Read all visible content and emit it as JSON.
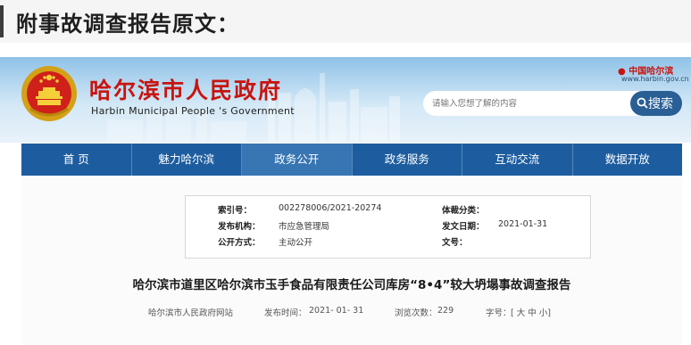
{
  "heading": "附事故调查报告原文：",
  "site": {
    "title": "哈尔滨市人民政府",
    "subtitle": "Harbin Municipal People 's Government",
    "china_logo": "中国哈尔滨",
    "china_url": "www.harbin.gov.cn"
  },
  "search": {
    "placeholder": "请输入您想了解的内容",
    "button": "搜索"
  },
  "nav": {
    "items": [
      "首 页",
      "魅力哈尔滨",
      "政务公开",
      "政务服务",
      "互动交流",
      "数据开放"
    ],
    "active_index": 2
  },
  "info": {
    "index_label": "索引号：",
    "index_value": "002278006/2021-20274",
    "genre_label": "体裁分类：",
    "genre_value": "",
    "org_label": "发布机构：",
    "org_value": "市应急管理局",
    "date_label": "发文日期：",
    "date_value": "2021-01-31",
    "mode_label": "公开方式：",
    "mode_value": "主动公开",
    "doc_label": "文号：",
    "doc_value": ""
  },
  "article": {
    "title": "哈尔滨市道里区哈尔滨市玉手食品有限责任公司库房“8•4”较大坍塌事故调查报告",
    "source": "哈尔滨市人民政府网站",
    "publish_label": "发布时间：",
    "publish_date": "2021- 01- 31",
    "views_label": "浏览次数：",
    "views": "229",
    "font_label": "字号：",
    "font_sizes": "[ 大 中 小]"
  },
  "colors": {
    "nav_bg": "#1d5d9f",
    "nav_active": "#3775b3",
    "title_red": "#c8140f",
    "search_button": "#2a5f95"
  }
}
